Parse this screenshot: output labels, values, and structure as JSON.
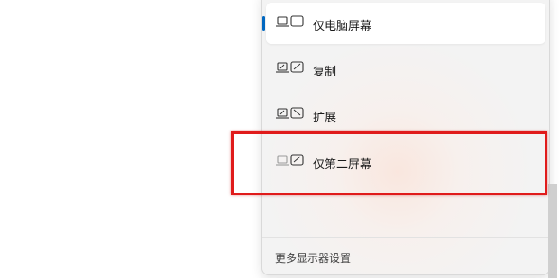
{
  "project_menu": {
    "options": [
      {
        "label": "仅电脑屏幕",
        "icon": "pc-screen-only-icon",
        "selected": true
      },
      {
        "label": "复制",
        "icon": "duplicate-icon",
        "selected": false
      },
      {
        "label": "扩展",
        "icon": "extend-icon",
        "selected": false
      },
      {
        "label": "仅第二屏幕",
        "icon": "second-screen-only-icon",
        "selected": false
      }
    ],
    "footer_link": "更多显示器设置"
  },
  "colors": {
    "accent": "#0067c0",
    "highlight": "#e01b1b"
  }
}
